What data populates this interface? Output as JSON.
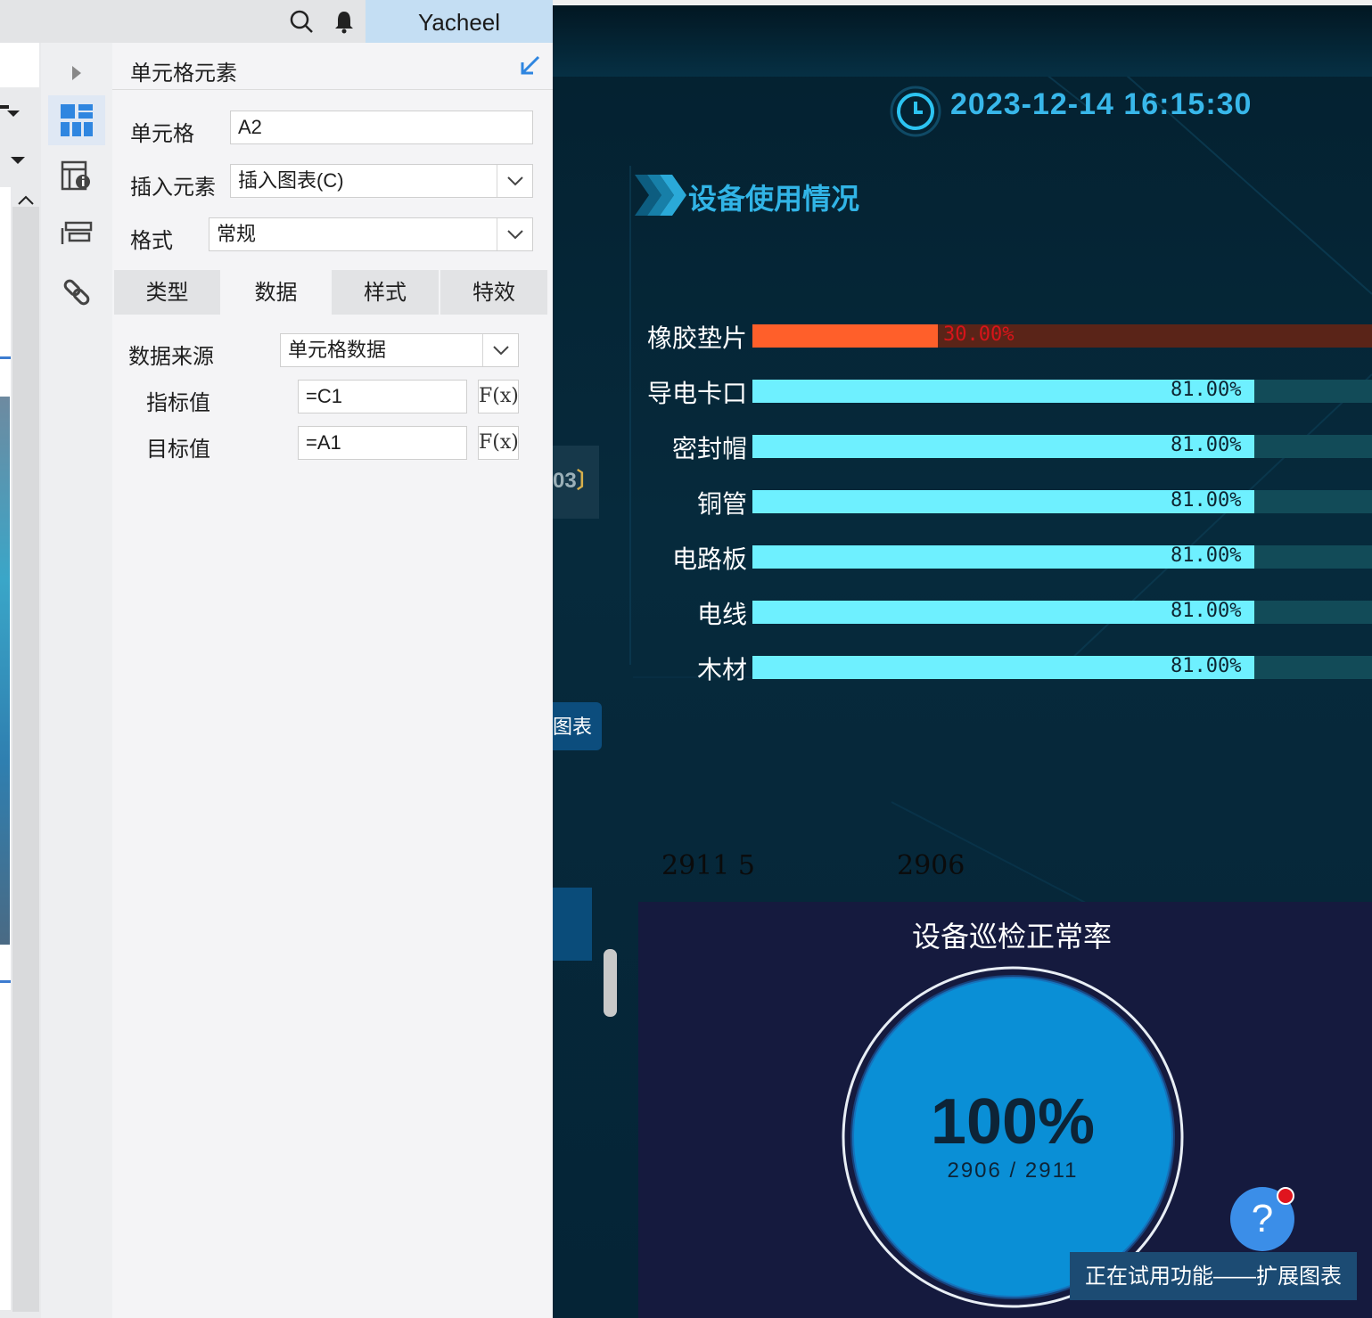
{
  "topbar": {
    "username": "Yacheel",
    "search_icon": "search-icon",
    "bell_icon": "bell-icon"
  },
  "panel": {
    "title": "单元格元素",
    "cell_label": "单元格",
    "cell_value": "A2",
    "insert_label": "插入元素",
    "insert_value": "插入图表(C)",
    "format_label": "格式",
    "format_value": "常规",
    "tabs": [
      {
        "label": "类型"
      },
      {
        "label": "数据"
      },
      {
        "label": "样式"
      },
      {
        "label": "特效"
      }
    ],
    "active_tab": "数据",
    "data_source_label": "数据来源",
    "data_source_value": "单元格数据",
    "indicator_label": "指标值",
    "indicator_value": "=C1",
    "target_label": "目标值",
    "target_value": "=A1",
    "fx_label": "F(x)"
  },
  "dashboard": {
    "datetime": "2023-12-14 16:15:30",
    "section_title": "设备使用情况",
    "side_tag": "03",
    "side_button": "图表",
    "numbers": [
      "2911 5",
      "2906"
    ],
    "gauge_title": "设备巡检正常率",
    "gauge_percent": "100%",
    "gauge_sub": "2906 / 2911",
    "help_label": "?",
    "trial_banner": "正在试用功能——扩展图表",
    "colors": {
      "accent": "#31b4e6",
      "bar_cyan": "#6ef0ff",
      "bar_orange": "#ff5f2a",
      "gauge_fill": "#0a8fd6"
    }
  },
  "chart_data": {
    "type": "bar",
    "orientation": "horizontal",
    "title": "设备使用情况",
    "categories": [
      "橡胶垫片",
      "导电卡口",
      "密封帽",
      "铜管",
      "电路板",
      "电线",
      "木材"
    ],
    "values": [
      30.0,
      81.0,
      81.0,
      81.0,
      81.0,
      81.0,
      81.0
    ],
    "value_labels": [
      "30.00%",
      "81.00%",
      "81.00%",
      "81.00%",
      "81.00%",
      "81.00%",
      "81.00%"
    ],
    "unit": "%",
    "xlim": [
      0,
      100
    ],
    "grid": false,
    "legend": "none"
  }
}
